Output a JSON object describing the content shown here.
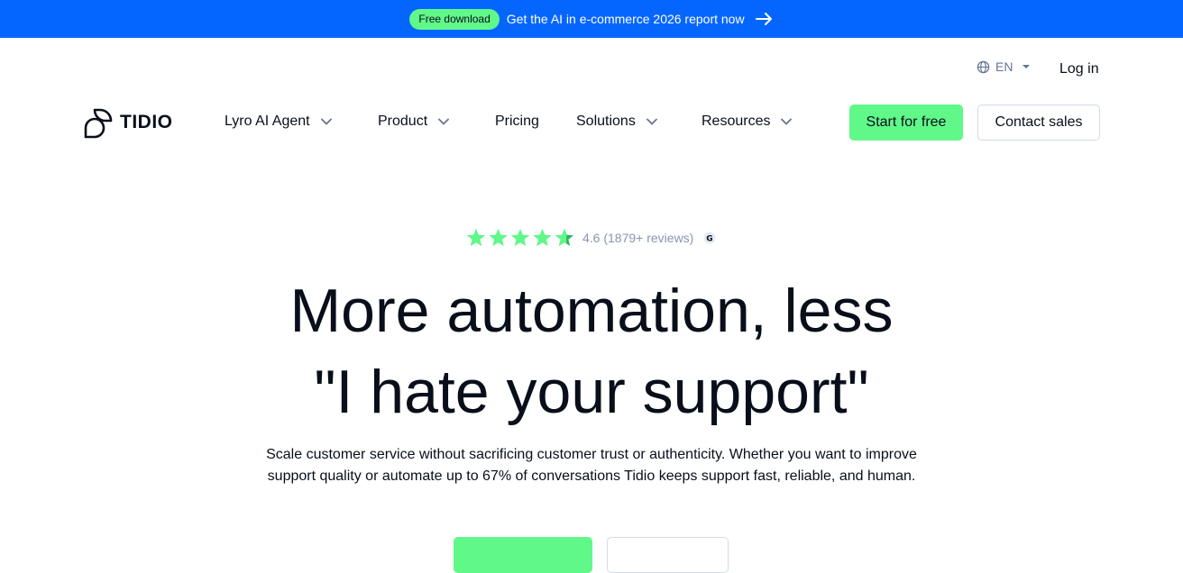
{
  "banner": {
    "pill_label": "Free download",
    "text": "Get the AI in e-commerce 2026 report now",
    "bg_color": "#0566ff",
    "pill_color": "#60f889",
    "arrow_icon": "arrow-right-icon"
  },
  "utility": {
    "language": "EN",
    "language_icon": "globe-icon",
    "login": "Log in"
  },
  "logo": {
    "text": "TIDIO",
    "icon": "tidio-logo-icon"
  },
  "nav": {
    "items": [
      {
        "label": "Lyro AI Agent",
        "has_dropdown": true
      },
      {
        "label": "Product",
        "has_dropdown": true
      },
      {
        "label": "Pricing",
        "has_dropdown": false
      },
      {
        "label": "Solutions",
        "has_dropdown": true
      },
      {
        "label": "Resources",
        "has_dropdown": true
      }
    ],
    "start_button": "Start for free",
    "contact_button": "Contact sales",
    "accent_color": "#60f889"
  },
  "hero": {
    "rating_value": "4.6",
    "rating_text": "4.6 (1879+ reviews)",
    "stars": 4.6,
    "source_icon": "g2-icon",
    "headline_line1": "More automation, less",
    "headline_line2": "\"I hate your support\"",
    "sub_line1": "Scale customer service without sacrificing customer trust or authenticity. Whether you want to improve",
    "sub_line2": "support quality or automate up to 67% of conversations Tidio keeps support fast, reliable, and human."
  }
}
